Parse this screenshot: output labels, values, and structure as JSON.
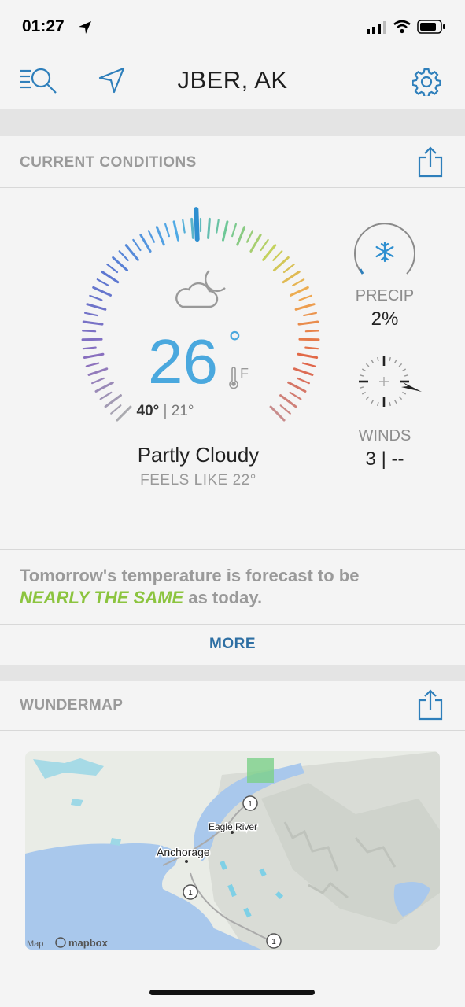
{
  "status_bar": {
    "time": "01:27"
  },
  "header": {
    "location": "JBER, AK"
  },
  "current_conditions": {
    "section_title": "CURRENT CONDITIONS",
    "temperature": "26",
    "degree": "°",
    "unit": "F",
    "high": "40°",
    "divider": "|",
    "low": "21°",
    "condition": "Partly Cloudy",
    "feels_like": "FEELS LIKE 22°",
    "precip_label": "PRECIP",
    "precip_value": "2%",
    "winds_label": "WINDS",
    "winds_value": "3 | --",
    "icons": {
      "weather": "partly-cloudy-night-icon",
      "precip": "snowflake-icon",
      "wind": "wind-compass-icon"
    }
  },
  "forecast": {
    "lead": "Tomorrow's temperature is forecast to be",
    "highlight": "NEARLY THE SAME",
    "tail": " as today.",
    "highlight_color": "#8cc43f",
    "more_label": "MORE"
  },
  "wundermap": {
    "section_title": "WUNDERMAP",
    "labels": {
      "city1": "Eagle River",
      "city2": "Anchorage",
      "credit1": "Map",
      "credit2": "mapbox"
    },
    "route_markers": [
      "1",
      "1",
      "1"
    ]
  },
  "colors": {
    "accent": "#2e6fa3",
    "temp": "#4aa8de",
    "highlight": "#8cc43f"
  }
}
